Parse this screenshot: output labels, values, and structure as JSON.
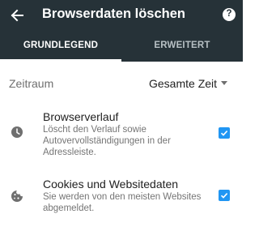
{
  "header": {
    "title": "Browserdaten löschen",
    "back_icon": "arrow-back-icon",
    "help_icon": "help-icon",
    "help_glyph": "?",
    "background": "#263238"
  },
  "tabs": [
    {
      "label": "GRUNDLEGEND",
      "active": true
    },
    {
      "label": "ERWEITERT",
      "active": false
    }
  ],
  "time_range": {
    "label": "Zeitraum",
    "value": "Gesamte Zeit",
    "dropdown_icon": "dropdown-caret-icon"
  },
  "items": [
    {
      "title": "Browserverlauf",
      "description": "Löscht den Verlauf sowie Autovervollständigungen in der Adressleiste.",
      "icon": "clock-icon",
      "checked": true
    },
    {
      "title": "Cookies und Websitedaten",
      "description": "Sie werden von den meisten Websites abgemeldet.",
      "icon": "cookie-icon",
      "checked": true
    }
  ],
  "colors": {
    "accent": "#2196f3",
    "appbar": "#263238"
  }
}
